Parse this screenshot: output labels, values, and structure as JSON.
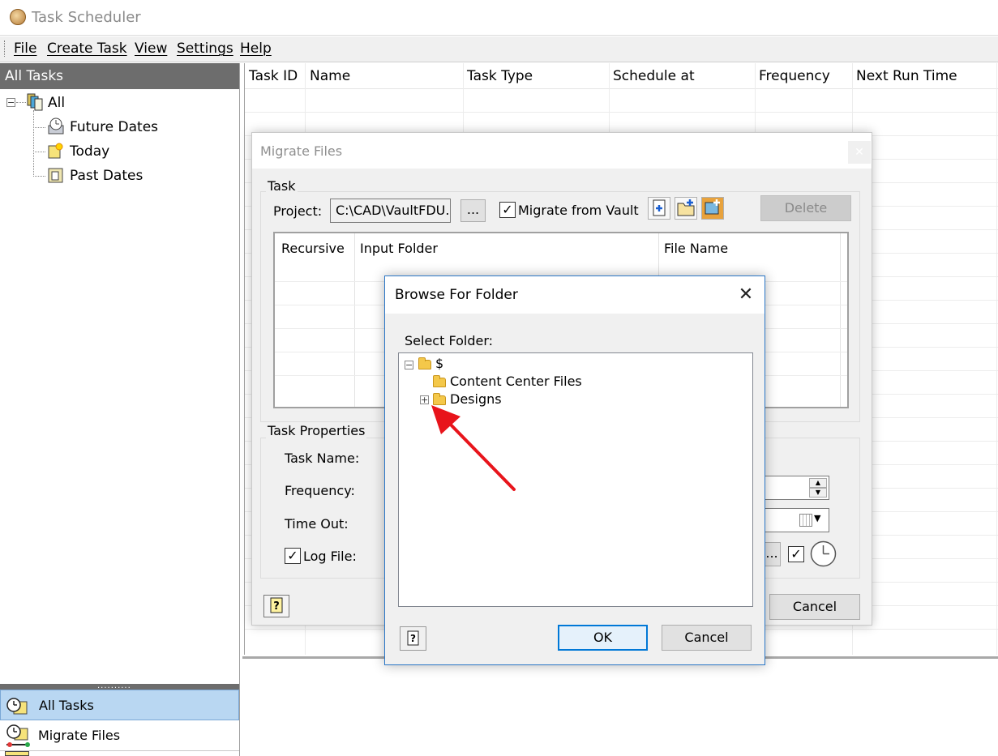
{
  "app": {
    "title": "Task Scheduler"
  },
  "menu": [
    "File",
    "Create Task",
    "View",
    "Settings",
    "Help"
  ],
  "left_pane": {
    "header": "All Tasks",
    "tree": {
      "root": "All",
      "children": [
        "Future Dates",
        "Today",
        "Past Dates"
      ]
    },
    "nav_buttons": [
      "All Tasks",
      "Migrate Files"
    ]
  },
  "grid": {
    "columns": [
      "Task ID",
      "Name",
      "Task Type",
      "Schedule at",
      "Frequency",
      "Next Run Time"
    ]
  },
  "migrate_dialog": {
    "title": "Migrate Files",
    "task_group": "Task",
    "project_label": "Project:",
    "project_value": "C:\\CAD\\VaultFDU.ip",
    "browse_button": "...",
    "migrate_from_vault_label": "Migrate from Vault",
    "migrate_from_vault_checked": true,
    "delete_button": "Delete",
    "table_columns": [
      "Recursive",
      "Input Folder",
      "File Name"
    ],
    "properties_group": "Task Properties",
    "task_name_label": "Task Name:",
    "frequency_label": "Frequency:",
    "time_out_label": "Time Out:",
    "log_file_label": "Log File:",
    "log_file_checked": true,
    "log_browse_button": "...",
    "cancel_button": "Cancel"
  },
  "browse_dialog": {
    "title": "Browse For Folder",
    "select_label": "Select Folder:",
    "folders": {
      "root": "$",
      "children": [
        "Content Center Files",
        "Designs"
      ]
    },
    "ok_button": "OK",
    "cancel_button": "Cancel"
  },
  "colors": {
    "accent": "#2b77c7",
    "header_gray": "#6d6d6d",
    "selected_nav": "#b9d7f2",
    "arrow": "#e8141b"
  }
}
